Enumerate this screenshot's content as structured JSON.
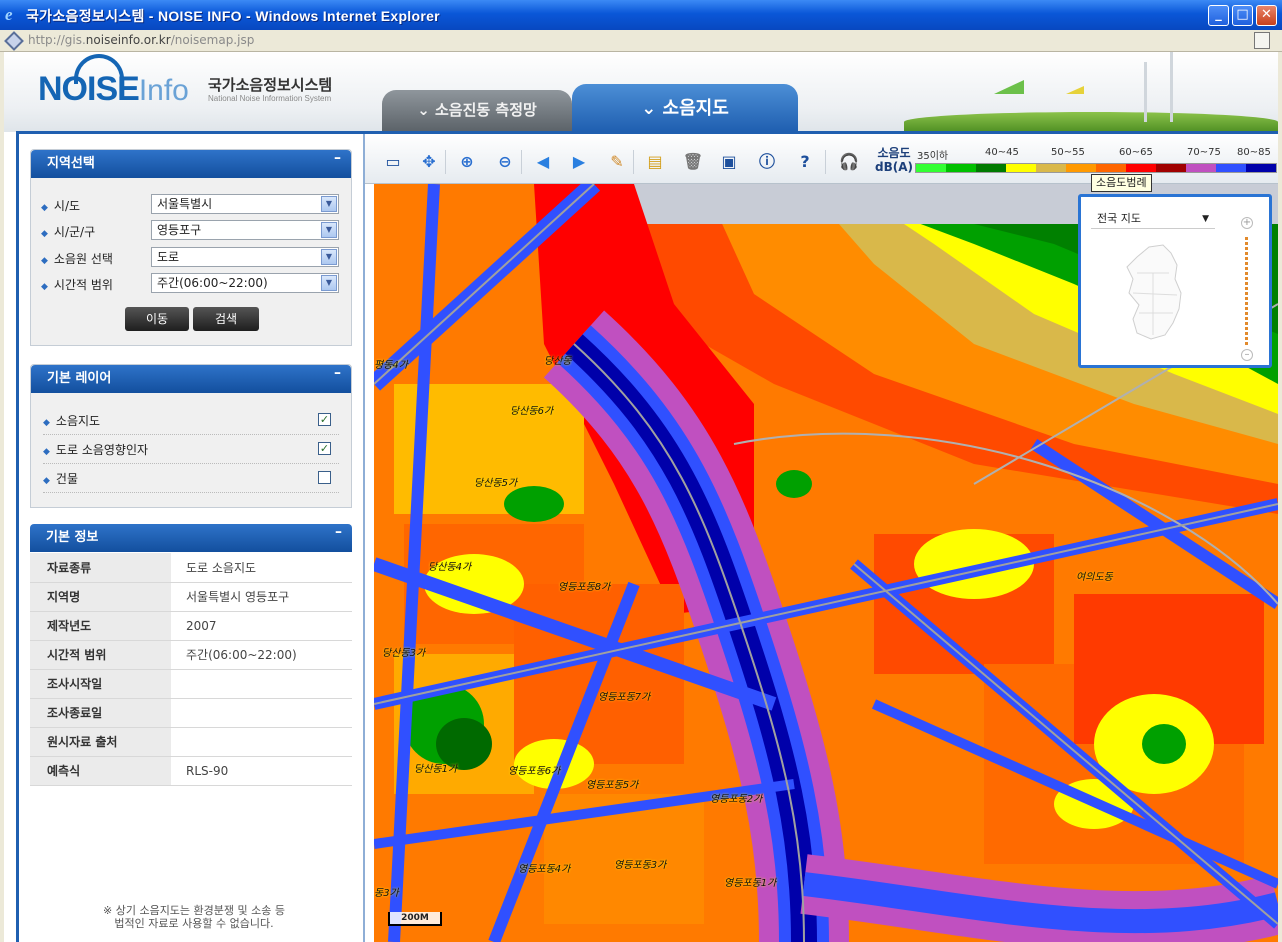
{
  "window": {
    "title": "국가소음정보시스템 - NOISE INFO - Windows Internet Explorer",
    "url_prefix": "http://gis.",
    "url_host": "noiseinfo.or.kr",
    "url_path": "/noisemap.jsp",
    "btn_min": "_",
    "btn_max": "□",
    "btn_close": "✕"
  },
  "header": {
    "logo_noise": "NOISE",
    "logo_info": "Info",
    "logo_kr": "국가소음정보시스템",
    "logo_en": "National Noise Information System",
    "tab1": "소음진동 측정망",
    "tab2": "소음지도"
  },
  "region": {
    "title": "지역선택",
    "minimize": "–",
    "fields": [
      {
        "label": "시/도",
        "value": "서울특별시"
      },
      {
        "label": "시/군/구",
        "value": "영등포구"
      },
      {
        "label": "소음원 선택",
        "value": "도로"
      },
      {
        "label": "시간적 범위",
        "value": "주간(06:00~22:00)"
      }
    ],
    "move_label": "이동",
    "search_label": "검색"
  },
  "layers": {
    "title": "기본 레이어",
    "minimize": "–",
    "items": [
      {
        "label": "소음지도",
        "checked": "✓"
      },
      {
        "label": "도로 소음영향인자",
        "checked": "✓"
      },
      {
        "label": "건물",
        "checked": ""
      }
    ]
  },
  "info": {
    "title": "기본 정보",
    "minimize": "–",
    "rows": [
      {
        "key": "자료종류",
        "value": "도로 소음지도"
      },
      {
        "key": "지역명",
        "value": "서울특별시 영등포구"
      },
      {
        "key": "제작년도",
        "value": "2007"
      },
      {
        "key": "시간적 범위",
        "value": "주간(06:00~22:00)"
      },
      {
        "key": "조사시작일",
        "value": ""
      },
      {
        "key": "조사종료일",
        "value": ""
      },
      {
        "key": "원시자료 출처",
        "value": ""
      },
      {
        "key": "예측식",
        "value": "RLS-90"
      }
    ],
    "note_line1": "※ 상기 소음지도는 환경분쟁 및 소송 등",
    "note_line2": "법적인 자료로 사용할 수 없습니다."
  },
  "toolbar": {
    "icons": [
      "full-extent",
      "pan",
      "zoom-in",
      "zoom-out",
      "previous",
      "next",
      "measure",
      "identify",
      "clear",
      "save",
      "info",
      "help",
      "listen"
    ],
    "legend_title_1": "소음도",
    "legend_title_2": "dB(A)",
    "legend_labels": [
      "35이하",
      "40~45",
      "50~55",
      "60~65",
      "70~75",
      "80~85"
    ],
    "legend_colors": [
      "#33ff33",
      "#00c000",
      "#007a00",
      "#ffff00",
      "#d9b84a",
      "#ff9900",
      "#ff6600",
      "#ff0000",
      "#a00000",
      "#c050c0",
      "#3050ff",
      "#0000aa"
    ]
  },
  "map": {
    "tooltip": "소음도범례",
    "overview_select": "전국 지도",
    "overview_arrow": "▼",
    "zoom_plus": "+",
    "zoom_minus": "–",
    "scale": "200M",
    "labels": [
      "평동4가",
      "당산동",
      "당산동6가",
      "당산동5가",
      "당산동4가",
      "영등포동8가",
      "여의도동",
      "당산동3가",
      "영등포동7가",
      "당산동1가",
      "영등포동6가",
      "영등포동5가",
      "영등포동2가",
      "영등포동4가",
      "영등포동3가",
      "영등포동1가",
      "동3가"
    ]
  }
}
